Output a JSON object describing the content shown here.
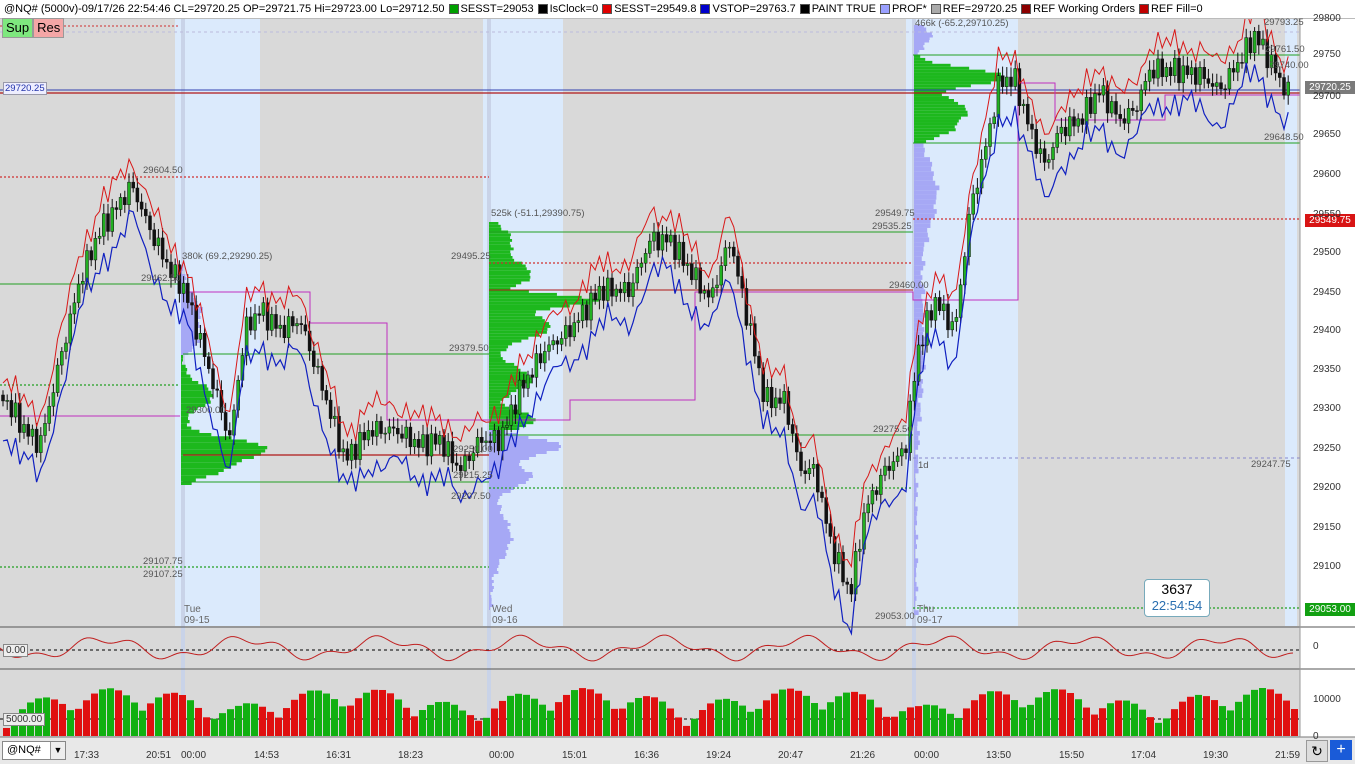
{
  "topbar": {
    "title": "@NQ# (5000v)-09/17/26 22:54:46 CL=29720.25 OP=29721.75 Hi=29723.00 Lo=29712.50",
    "indicators": [
      {
        "label": "SESST=29053",
        "color": "#00a000"
      },
      {
        "label": "IsClock=0",
        "color": "#000000"
      },
      {
        "label": "SESST=29549.8",
        "color": "#e00000"
      },
      {
        "label": "VSTOP=29763.7",
        "color": "#0000cc"
      },
      {
        "label": "PAINT TRUE",
        "color": "#000000"
      },
      {
        "label": "PROF*",
        "color": "#9aa0ff"
      },
      {
        "label": "REF=29720.25",
        "color": "#aaaaaa"
      },
      {
        "label": "REF Working Orders",
        "color": "#8b0000"
      },
      {
        "label": "REF Fill=0",
        "color": "#c00000"
      }
    ]
  },
  "buttons": {
    "sup": "Sup",
    "res": "Res"
  },
  "price_axis": [
    "29800",
    "29750",
    "29700",
    "29650",
    "29600",
    "29550",
    "29500",
    "29450",
    "29400",
    "29350",
    "29300",
    "29250",
    "29200",
    "29150",
    "29100"
  ],
  "price_boxes": {
    "last": "29720.25",
    "red": "29549.75",
    "green": "29053.00"
  },
  "left_price_tag": "29720.25",
  "chart_labels": [
    "29604.50",
    "380k (69.2,29290.25)",
    "29462.50",
    "29300.00",
    "29107.75",
    "29107.25",
    "525k (-51.1,29390.75)",
    "29495.25",
    "29379.50",
    "29250.00",
    "29215.25",
    "29207.50",
    "29549.75",
    "29535.25",
    "29460.00",
    "29275.50",
    "29053.00",
    "466k (-65.2,29710.25)",
    "29793.25",
    "29761.50",
    "29740.00",
    "29648.50",
    "29247.75",
    "1d"
  ],
  "day_labels": [
    {
      "day": "Tue",
      "date": "09-15"
    },
    {
      "day": "Wed",
      "date": "09-16"
    },
    {
      "day": "Thu",
      "date": "09-17"
    }
  ],
  "time_axis": [
    "17:33",
    "20:51",
    "00:00",
    "14:53",
    "16:31",
    "18:23",
    "00:00",
    "15:01",
    "16:36",
    "19:24",
    "20:47",
    "21:26",
    "00:00",
    "13:50",
    "15:50",
    "17:04",
    "19:30",
    "21:59"
  ],
  "osc_axis": "0",
  "osc_label": "0.00",
  "vol_axis": [
    "10000",
    "0"
  ],
  "vol_label": "5000.00",
  "info_box": {
    "volume": "3637",
    "time": "22:54:54"
  },
  "symbol": "@NQ#"
}
